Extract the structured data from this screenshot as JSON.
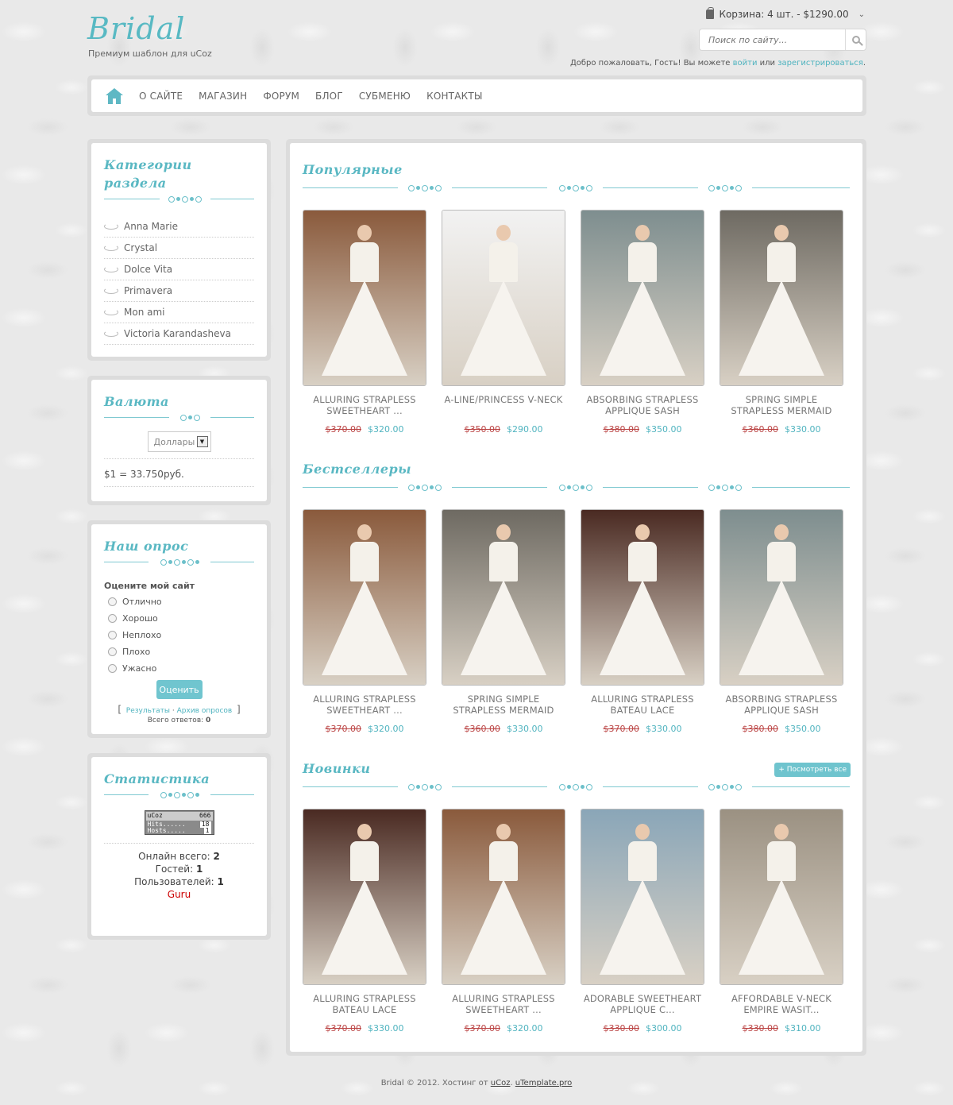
{
  "header": {
    "logo": "Bridal",
    "tagline": "Премиум шаблон для uCoz",
    "cart": "Корзина: 4 шт. - $1290.00",
    "search_placeholder": "Поиск по сайту...",
    "welcome_prefix": "Добро пожаловать, Гость! Вы можете ",
    "login": "войти",
    "or": " или ",
    "register": "зарегистрироваться",
    "period": "."
  },
  "nav": {
    "items": [
      "О САЙТЕ",
      "МАГАЗИН",
      "ФОРУМ",
      "БЛОГ",
      "СУБМЕНЮ",
      "КОНТАКТЫ"
    ]
  },
  "sidebar": {
    "categories": {
      "title": "Категории раздела",
      "items": [
        "Anna Marie",
        "Crystal",
        "Dolce Vita",
        "Primavera",
        "Mon ami",
        "Victoria Karandasheva"
      ]
    },
    "currency": {
      "title": "Валюта",
      "selected": "Доллары",
      "rate": "$1 = 33.750руб."
    },
    "poll": {
      "title": "Наш опрос",
      "question": "Оцените мой сайт",
      "options": [
        "Отлично",
        "Хорошо",
        "Неплохо",
        "Плохо",
        "Ужасно"
      ],
      "vote": "Оценить",
      "results": "Результаты",
      "archive": "Архив опросов",
      "total_label": "Всего ответов: ",
      "total": "0"
    },
    "stats": {
      "title": "Статистика",
      "counter_brand": "uCoz",
      "counter_total": "666",
      "hits_label": "Hits......",
      "hits": "18",
      "hosts_label": "Hosts.....",
      "hosts": "1",
      "online_label": "Онлайн всего: ",
      "online": "2",
      "guests_label": "Гостей: ",
      "guests": "1",
      "users_label": "Пользователей: ",
      "users": "1",
      "user_name": "Guru"
    }
  },
  "sections": [
    {
      "title": "Популярные",
      "products": [
        {
          "name": "ALLURING STRAPLESS SWEETHEART ...",
          "old": "$370.00",
          "new": "$320.00",
          "bg": "#8a5a3c"
        },
        {
          "name": "A-LINE/PRINCESS V-NECK",
          "old": "$350.00",
          "new": "$290.00",
          "bg": "#f2f2f2"
        },
        {
          "name": "ABSORBING STRAPLESS APPLIQUE SASH",
          "old": "$380.00",
          "new": "$350.00",
          "bg": "#7e8e8f"
        },
        {
          "name": "SPRING SIMPLE STRAPLESS MERMAID",
          "old": "$360.00",
          "new": "$330.00",
          "bg": "#6e6a62"
        }
      ]
    },
    {
      "title": "Бестселлеры",
      "products": [
        {
          "name": "ALLURING STRAPLESS SWEETHEART ...",
          "old": "$370.00",
          "new": "$320.00",
          "bg": "#8a5a3c"
        },
        {
          "name": "SPRING SIMPLE STRAPLESS MERMAID",
          "old": "$360.00",
          "new": "$330.00",
          "bg": "#6e6a62"
        },
        {
          "name": "ALLURING STRAPLESS BATEAU LACE",
          "old": "$370.00",
          "new": "$330.00",
          "bg": "#4a2a22"
        },
        {
          "name": "ABSORBING STRAPLESS APPLIQUE SASH",
          "old": "$380.00",
          "new": "$350.00",
          "bg": "#7e8e8f"
        }
      ]
    },
    {
      "title": "Новинки",
      "view_all": "+ Посмотреть все",
      "products": [
        {
          "name": "ALLURING STRAPLESS BATEAU LACE",
          "old": "$370.00",
          "new": "$330.00",
          "bg": "#4a2a22"
        },
        {
          "name": "ALLURING STRAPLESS SWEETHEART ...",
          "old": "$370.00",
          "new": "$320.00",
          "bg": "#8a5a3c"
        },
        {
          "name": "ADORABLE SWEETHEART APPLIQUE C...",
          "old": "$330.00",
          "new": "$300.00",
          "bg": "#8aa6b8"
        },
        {
          "name": "AFFORDABLE V-NECK EMPIRE WASIT...",
          "old": "$330.00",
          "new": "$310.00",
          "bg": "#9b9182"
        }
      ]
    }
  ],
  "footer": {
    "text": "Bridal © 2012. Хостинг от ",
    "ucoz": "uCoz",
    "sep": ". ",
    "utemplate": "uTemplate.pro"
  },
  "colors": {
    "accent": "#5ab8c3",
    "old_price": "#b44444",
    "new_price": "#4fb3bf"
  }
}
